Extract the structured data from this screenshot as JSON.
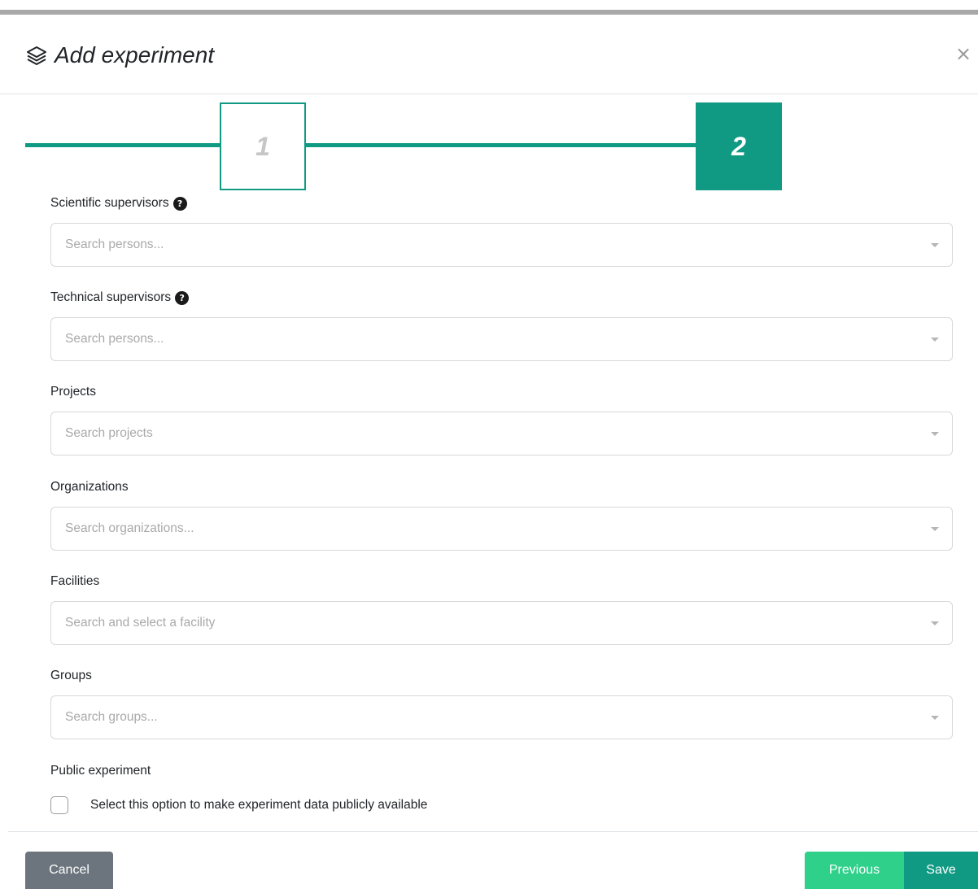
{
  "modal": {
    "title": "Add experiment",
    "title_icon": "layers-icon",
    "close_symbol": "×"
  },
  "stepper": {
    "steps": [
      {
        "label": "1",
        "state": "inactive"
      },
      {
        "label": "2",
        "state": "active"
      }
    ],
    "accent_color": "#119a83"
  },
  "fields": {
    "scientific_supervisors": {
      "label": "Scientific supervisors",
      "help": "?",
      "placeholder": "Search persons..."
    },
    "technical_supervisors": {
      "label": "Technical supervisors",
      "help": "?",
      "placeholder": "Search persons..."
    },
    "projects": {
      "label": "Projects",
      "placeholder": "Search projects"
    },
    "organizations": {
      "label": "Organizations",
      "placeholder": "Search organizations..."
    },
    "facilities": {
      "label": "Facilities",
      "placeholder": "Search and select a facility"
    },
    "groups": {
      "label": "Groups",
      "placeholder": "Search groups..."
    }
  },
  "public": {
    "label": "Public experiment",
    "checkbox_text": "Select this option to make experiment data publicly available",
    "checked": false
  },
  "footer": {
    "cancel_label": "Cancel",
    "previous_label": "Previous",
    "save_label": "Save"
  }
}
